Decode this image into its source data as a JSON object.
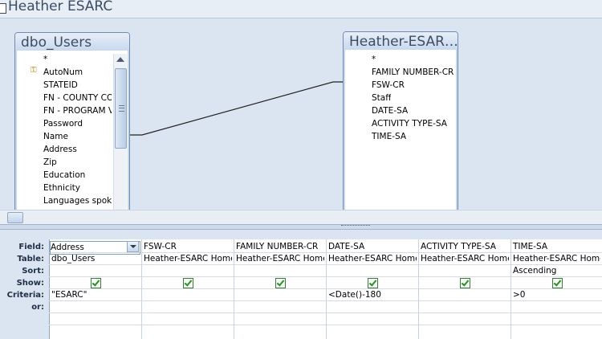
{
  "window": {
    "title": "Heather ESARC"
  },
  "tables": [
    {
      "name": "dbo_Users",
      "fields": [
        "*",
        "AutoNum",
        "STATEID",
        "FN - COUNTY CO",
        "FN - PROGRAM V",
        "Password",
        "Name",
        "Address",
        "Zip",
        "Education",
        "Ethnicity",
        "Languages spoke"
      ],
      "key_field": "AutoNum"
    },
    {
      "name": "Heather-ESAR…",
      "fields": [
        "*",
        "FAMILY NUMBER-CR",
        "FSW-CR",
        "Staff",
        "DATE-SA",
        "ACTIVITY TYPE-SA",
        "TIME-SA"
      ]
    }
  ],
  "grid": {
    "row_labels": [
      "Field:",
      "Table:",
      "Sort:",
      "Show:",
      "Criteria:",
      "or:"
    ],
    "columns": [
      {
        "field": "Address",
        "table": "dbo_Users",
        "sort": "",
        "show": true,
        "criteria": "\"ESARC\"",
        "or": ""
      },
      {
        "field": "FSW-CR",
        "table": "Heather-ESARC Home",
        "sort": "",
        "show": true,
        "criteria": "",
        "or": ""
      },
      {
        "field": "FAMILY NUMBER-CR",
        "table": "Heather-ESARC Home",
        "sort": "",
        "show": true,
        "criteria": "",
        "or": ""
      },
      {
        "field": "DATE-SA",
        "table": "Heather-ESARC Home",
        "sort": "",
        "show": true,
        "criteria": "<Date()-180",
        "or": ""
      },
      {
        "field": "ACTIVITY TYPE-SA",
        "table": "Heather-ESARC Home",
        "sort": "",
        "show": true,
        "criteria": "",
        "or": ""
      },
      {
        "field": "TIME-SA",
        "table": "Heather-ESARC Home",
        "sort": "Ascending",
        "show": true,
        "criteria": ">0",
        "or": ""
      }
    ]
  },
  "icons": {
    "key": "primary-key-icon",
    "dropdown": "chevron-down-icon",
    "scroll_up": "scroll-up-arrow-icon"
  },
  "colors": {
    "accent": "#6f8db3",
    "checkbox": "#2e8b2e",
    "key": "#b8860b"
  }
}
